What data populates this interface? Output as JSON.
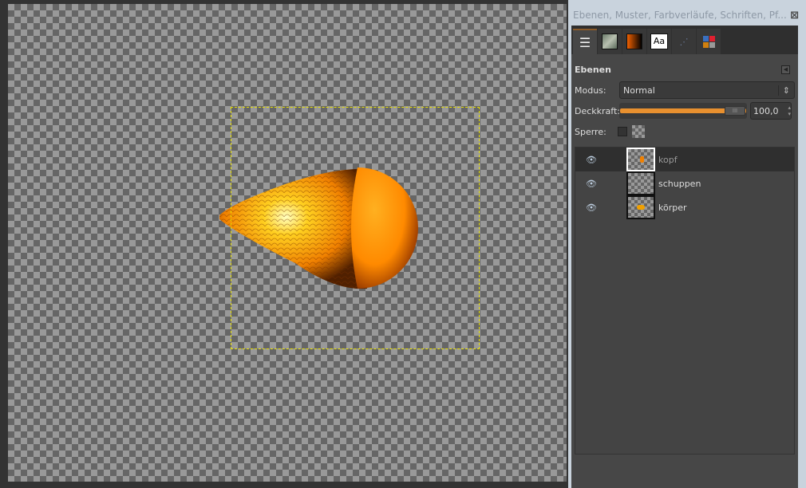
{
  "panel": {
    "title": "Ebenen, Muster, Farbverläufe, Schriften, Pf...",
    "close_icon": "close-icon"
  },
  "tabs": [
    {
      "icon": "layers-icon"
    },
    {
      "icon": "pattern-icon"
    },
    {
      "icon": "gradient-icon"
    },
    {
      "icon": "fonts-icon",
      "label": "Aa"
    },
    {
      "icon": "paths-icon"
    },
    {
      "icon": "palette-icon"
    }
  ],
  "layers_panel": {
    "title": "Ebenen",
    "mode_label": "Modus:",
    "mode_value": "Normal",
    "opacity_label": "Deckkraft:",
    "opacity_value": "100,0",
    "opacity_percent": 100,
    "lock_label": "Sperre:",
    "layers": [
      {
        "name": "kopf",
        "visible": true,
        "selected": true
      },
      {
        "name": "schuppen",
        "visible": true,
        "selected": false
      },
      {
        "name": "körper",
        "visible": true,
        "selected": false
      }
    ]
  },
  "colors": {
    "accent": "#e8902f",
    "selection": "#e8e000"
  }
}
